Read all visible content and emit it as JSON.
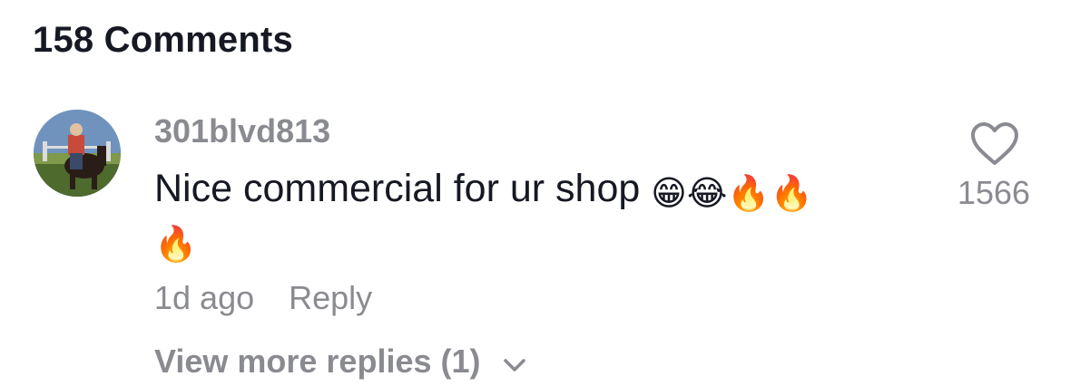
{
  "header": {
    "title": "158 Comments"
  },
  "comment": {
    "username": "301blvd813",
    "text": "Nice commercial for ur shop",
    "emojis": [
      "😁",
      "😂",
      "🔥",
      "🔥",
      "🔥"
    ],
    "time": "1d ago",
    "reply_label": "Reply",
    "like_count": "1566",
    "view_more": "View more replies (1)",
    "icons": {
      "like": "heart-outline-icon",
      "expand": "chevron-down-icon",
      "avatar": "user-avatar"
    }
  },
  "colors": {
    "primary_text": "#161823",
    "secondary_text": "#8a8b91",
    "background": "#ffffff"
  }
}
